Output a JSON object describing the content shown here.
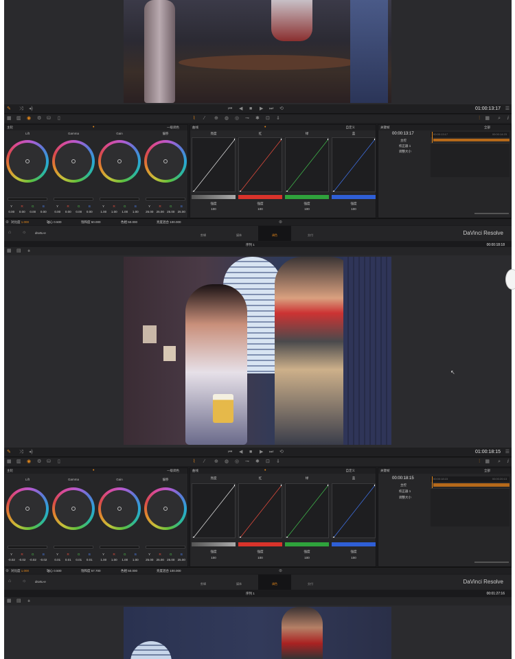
{
  "app": {
    "brand": "DaVinci Resolve",
    "clip_name": "drortu-e"
  },
  "colors": {
    "accent": "#e88a1b"
  },
  "icons": [
    "pen-icon",
    "shuffle-icon",
    "speaker-icon",
    "skip-start-icon",
    "prev-icon",
    "stop-icon",
    "play-icon",
    "skip-end-icon",
    "loop-icon",
    "menu-icon",
    "grid-icon",
    "palette-icon",
    "search-icon",
    "info-icon",
    "home-icon",
    "gear-icon",
    "cursor-icon"
  ],
  "grade1": {
    "timecode": "01:00:13:17",
    "primaries_title": "主轮",
    "mode_label": "一级调色",
    "wheels": [
      {
        "label": "Lift",
        "values": [
          "0.00",
          "0.00",
          "0.00",
          "0.00"
        ]
      },
      {
        "label": "Gamma",
        "values": [
          "0.00",
          "0.00",
          "0.00",
          "0.00"
        ]
      },
      {
        "label": "Gain",
        "values": [
          "1.00",
          "1.00",
          "1.00",
          "1.00"
        ]
      },
      {
        "label": "偏移",
        "values": [
          "25.00",
          "25.00",
          "25.00",
          "25.00"
        ]
      }
    ],
    "channels": [
      "Y",
      "R",
      "G",
      "B"
    ],
    "curves_title": "曲线",
    "curves_mode": "自定义",
    "curve_names": [
      "亮度",
      "红",
      "绿",
      "蓝"
    ],
    "curve_labels": [
      "强度",
      "强度",
      "强度",
      "强度"
    ],
    "curve_values": [
      "100",
      "100",
      "100",
      "100"
    ],
    "stats": [
      {
        "label": "对比度",
        "value": "1.000"
      },
      {
        "label": "轴心",
        "value": "0.500"
      },
      {
        "label": "饱和度",
        "value": "50.000"
      },
      {
        "label": "色相",
        "value": "50.000"
      },
      {
        "label": "亮度混合",
        "value": "100.000"
      }
    ],
    "keyframes": {
      "title": "关键帧",
      "mode": "全部",
      "tc_main": "00:00:13:17",
      "tc_left": "00:00:13:17",
      "tc_right": "00:00:14:23",
      "rows": [
        "主控",
        "校正器 1",
        "调整大小"
      ]
    },
    "pages": [
      "剪辑",
      "媒体",
      "调色",
      "交付"
    ],
    "lower_timecode": "00:00:18:18",
    "track_label": "序列 1"
  },
  "grade2": {
    "timecode": "01:00:18:15",
    "primaries_title": "主轮",
    "mode_label": "一级调色",
    "wheels": [
      {
        "label": "Lift",
        "values": [
          "-0.02",
          "-0.02",
          "-0.02",
          "-0.02"
        ]
      },
      {
        "label": "Gamma",
        "values": [
          "0.01",
          "0.01",
          "0.01",
          "0.01"
        ]
      },
      {
        "label": "Gain",
        "values": [
          "1.00",
          "1.00",
          "1.00",
          "1.00"
        ]
      },
      {
        "label": "偏移",
        "values": [
          "25.00",
          "25.00",
          "25.00",
          "25.00"
        ]
      }
    ],
    "channels": [
      "Y",
      "R",
      "G",
      "B"
    ],
    "curves_title": "曲线",
    "curves_mode": "自定义",
    "curve_names": [
      "亮度",
      "红",
      "绿",
      "蓝"
    ],
    "curve_labels": [
      "强度",
      "强度",
      "强度",
      "强度"
    ],
    "curve_values": [
      "100",
      "100",
      "100",
      "100"
    ],
    "stats": [
      {
        "label": "对比度",
        "value": "1.000"
      },
      {
        "label": "轴心",
        "value": "0.500"
      },
      {
        "label": "饱和度",
        "value": "57.700"
      },
      {
        "label": "色相",
        "value": "50.000"
      },
      {
        "label": "亮度混合",
        "value": "100.000"
      }
    ],
    "keyframes": {
      "title": "关键帧",
      "mode": "全部",
      "tc_main": "00:00:18:15",
      "tc_left": "00:00:18:15",
      "tc_right": "00:00:20:13",
      "rows": [
        "主控",
        "校正器 1",
        "调整大小"
      ]
    },
    "pages": [
      "剪辑",
      "媒体",
      "调色",
      "交付"
    ],
    "lower_timecode": "00:01:27:16",
    "track_label": "序列 1"
  }
}
